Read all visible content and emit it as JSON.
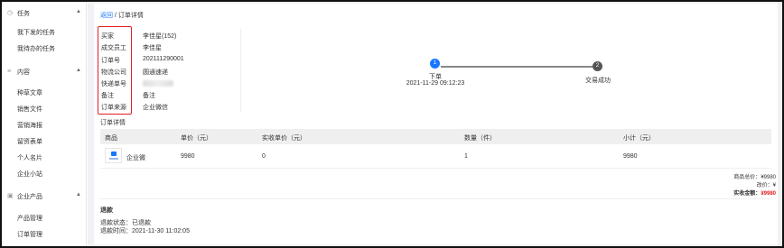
{
  "sidebar": {
    "sections": [
      {
        "label": "任务",
        "icon": "clock-icon",
        "arrow": "▲"
      },
      {
        "label": "内容",
        "icon": "list-icon",
        "arrow": "▲"
      },
      {
        "label": "企业产品",
        "icon": "box-icon",
        "arrow": "▲"
      }
    ],
    "items": {
      "task_sent": "我下发的任务",
      "task_todo": "我待办的任务",
      "article": "种草文章",
      "sales_doc": "销售文件",
      "poster": "营销海报",
      "form": "留资表单",
      "card": "个人名片",
      "site": "企业小站",
      "product_mgmt": "产品管理",
      "order_mgmt": "订单管理"
    }
  },
  "breadcrumb": {
    "back": "返回",
    "separator": " / ",
    "current": "订单详情"
  },
  "order_info": {
    "labels": [
      "买家",
      "成交员工",
      "订单号",
      "物流公司",
      "快递单号",
      "备注",
      "订单来源"
    ],
    "values": {
      "buyer": "李佳星(152)",
      "employee": "李佳星",
      "order_no": "202111290001",
      "logistics": "圆通速递",
      "tracking_no": "",
      "remark": "备注",
      "source": "企业微信"
    }
  },
  "steps": [
    {
      "num": "1",
      "title": "下单",
      "time": "2021-11-29 09:12:23"
    },
    {
      "num": "2",
      "title": "交易成功",
      "time": ""
    }
  ],
  "order_detail": {
    "title": "订单详情",
    "columns": [
      "商品",
      "单价（元）",
      "实收单价（元）",
      "数量（件）",
      "小计（元）"
    ],
    "row": {
      "product": "企业微",
      "price": "9980",
      "actual_price": "0",
      "qty": "1",
      "subtotal": "9980"
    }
  },
  "summary": {
    "total_label": "商品总价：",
    "total_value": "¥9980",
    "adjust_label": "改价：",
    "adjust_value": "¥",
    "paid_label": "实收金额：",
    "paid_value": "¥9980"
  },
  "refund": {
    "title": "退款",
    "status_label": "退款状态：",
    "status": "已退款",
    "time_label": "退款时间：",
    "time": "2021-11-30 11:02:05"
  },
  "colors": {
    "accent": "#1677ff",
    "highlight": "#e02020"
  }
}
